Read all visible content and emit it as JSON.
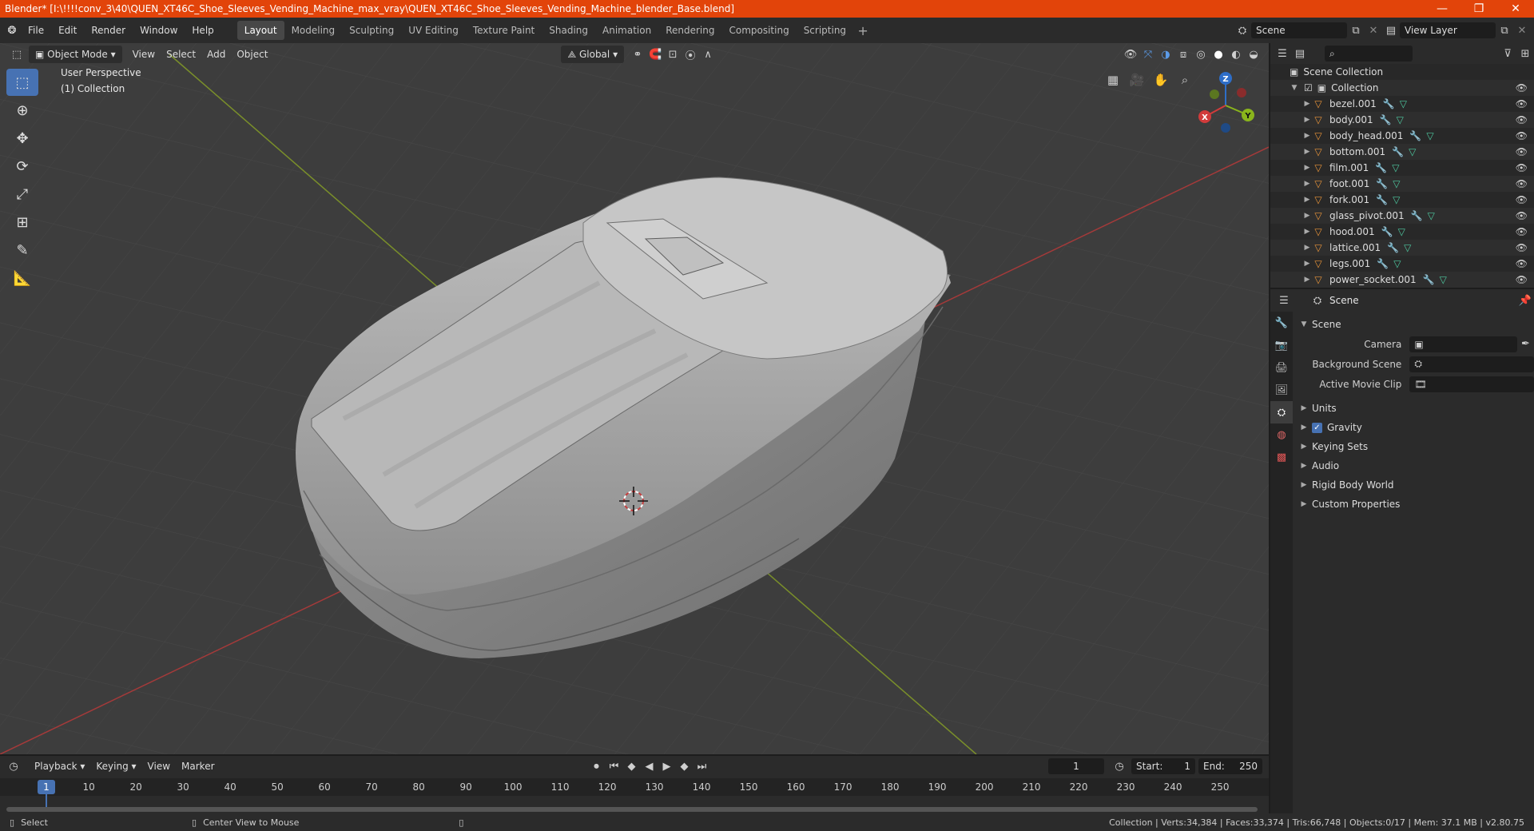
{
  "window": {
    "title": "Blender* [I:\\!!!!conv_3\\40\\QUEN_XT46C_Shoe_Sleeves_Vending_Machine_max_vray\\QUEN_XT46C_Shoe_Sleeves_Vending_Machine_blender_Base.blend]",
    "minimize": "—",
    "restore": "❐",
    "close": "✕",
    "accent": "#e2440a"
  },
  "menubar": {
    "items": [
      "File",
      "Edit",
      "Render",
      "Window",
      "Help"
    ]
  },
  "workspaces": {
    "tabs": [
      "Layout",
      "Modeling",
      "Sculpting",
      "UV Editing",
      "Texture Paint",
      "Shading",
      "Animation",
      "Rendering",
      "Compositing",
      "Scripting"
    ],
    "active": "Layout",
    "add": "+"
  },
  "scene_selector": {
    "value": "Scene"
  },
  "viewlayer_selector": {
    "value": "View Layer"
  },
  "viewport": {
    "mode": "Object Mode",
    "menus": [
      "View",
      "Select",
      "Add",
      "Object"
    ],
    "transform_orientation": "Global",
    "perspective_label": "User Perspective",
    "collection_label": "(1) Collection",
    "gizmo": {
      "x": "X",
      "y": "Y",
      "z": "Z"
    }
  },
  "outliner": {
    "root": "Scene Collection",
    "collection": "Collection",
    "items": [
      "bezel.001",
      "body.001",
      "body_head.001",
      "bottom.001",
      "film.001",
      "foot.001",
      "fork.001",
      "glass_pivot.001",
      "hood.001",
      "lattice.001",
      "legs.001",
      "power_socket.001"
    ]
  },
  "properties": {
    "header": "Scene",
    "section": "Scene",
    "fields": [
      {
        "label": "Camera",
        "value": ""
      },
      {
        "label": "Background Scene",
        "value": ""
      },
      {
        "label": "Active Movie Clip",
        "value": ""
      }
    ],
    "panels": [
      "Units",
      "Gravity",
      "Keying Sets",
      "Audio",
      "Rigid Body World",
      "Custom Properties"
    ],
    "gravity_checked": true
  },
  "timeline": {
    "menus": [
      "Playback",
      "Keying",
      "View",
      "Marker"
    ],
    "current_frame": "1",
    "start_label": "Start:",
    "start": "1",
    "end_label": "End:",
    "end": "250",
    "ticks": [
      "1",
      "10",
      "20",
      "30",
      "40",
      "50",
      "60",
      "70",
      "80",
      "90",
      "100",
      "110",
      "120",
      "130",
      "140",
      "150",
      "160",
      "170",
      "180",
      "190",
      "200",
      "210",
      "220",
      "230",
      "240",
      "250"
    ]
  },
  "statusbar": {
    "left": "Select",
    "middle": "Center View to Mouse",
    "right": "Collection | Verts:34,384 | Faces:33,374 | Tris:66,748 | Objects:0/17 | Mem: 37.1 MB | v2.80.75"
  }
}
